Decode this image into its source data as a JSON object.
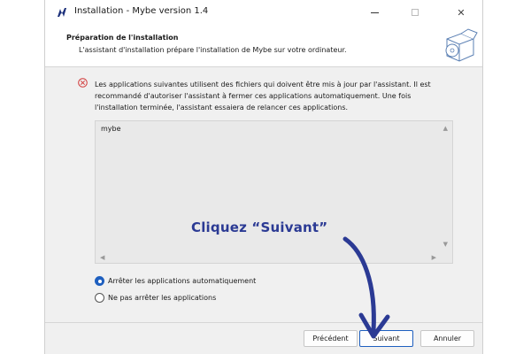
{
  "window": {
    "title": "Installation - Mybe version 1.4",
    "min_glyph": "—",
    "close_glyph": "✕"
  },
  "header": {
    "title": "Préparation de l'installation",
    "subtitle": "L'assistant d'installation prépare l'installation de Mybe sur votre ordinateur."
  },
  "content": {
    "info_text": "Les applications suivantes utilisent des fichiers qui doivent être mis à jour par l'assistant. Il est recommandé d'autoriser l'assistant à fermer ces applications automatiquement. Une fois l'installation terminée, l'assistant essaiera de relancer ces applications.",
    "applications": [
      "mybe"
    ],
    "options": [
      {
        "label": "Arrêter les applications automatiquement",
        "selected": true
      },
      {
        "label": "Ne pas arrêter les applications",
        "selected": false
      }
    ]
  },
  "footer": {
    "prev_label": "Précédent",
    "next_label": "Suivant",
    "cancel_label": "Annuler"
  },
  "annotation": {
    "text": "Cliquez “Suivant”",
    "color": "#2b3a94"
  },
  "icons": {
    "app": "mybe-logo-icon",
    "box": "software-box-icon",
    "error": "error-circle-icon"
  }
}
